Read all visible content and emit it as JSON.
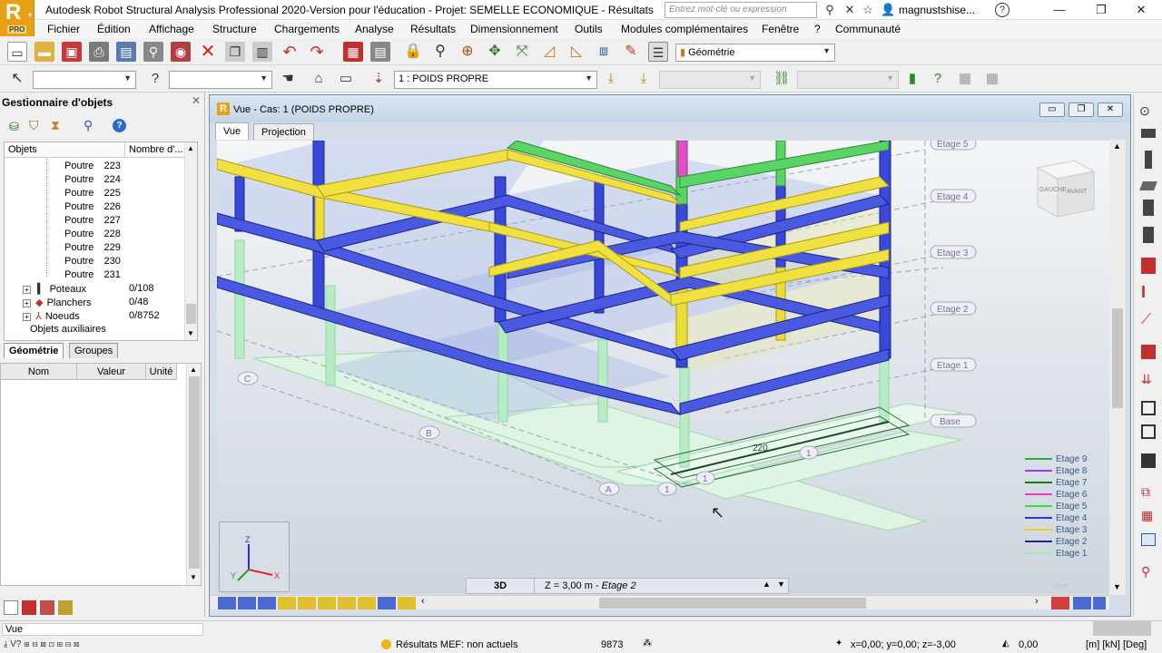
{
  "app": {
    "title": "Autodesk Robot Structural Analysis Professional 2020-Version pour l'éducation - Projet: SEMELLE ECONOMIQUE - Résultats MEF: non ...",
    "logo_letter": "R",
    "logo_badge": "PRO",
    "search_placeholder": "Entrez mot-clé ou expression",
    "user": "magnustshise...",
    "help": "?"
  },
  "menu": [
    "Fichier",
    "Édition",
    "Affichage",
    "Structure",
    "Chargements",
    "Analyse",
    "Résultats",
    "Dimensionnement",
    "Outils",
    "Modules complémentaires",
    "Fenêtre",
    "?",
    "Communauté"
  ],
  "toolbar": {
    "display_select": "Géométrie",
    "case_select": "1 : POIDS PROPRE",
    "combo_1": "",
    "combo_2": ""
  },
  "object_manager": {
    "title": "Gestionnaire d'objets",
    "col_objects": "Objets",
    "col_count": "Nombre d'...",
    "poutres": [
      {
        "label": "Poutre",
        "num": "223"
      },
      {
        "label": "Poutre",
        "num": "224"
      },
      {
        "label": "Poutre",
        "num": "225"
      },
      {
        "label": "Poutre",
        "num": "226"
      },
      {
        "label": "Poutre",
        "num": "227"
      },
      {
        "label": "Poutre",
        "num": "228"
      },
      {
        "label": "Poutre",
        "num": "229"
      },
      {
        "label": "Poutre",
        "num": "230"
      },
      {
        "label": "Poutre",
        "num": "231"
      }
    ],
    "groups": [
      {
        "label": "Poteaux",
        "count": "0/108"
      },
      {
        "label": "Planchers",
        "count": "0/48"
      },
      {
        "label": "Noeuds",
        "count": "0/8752"
      }
    ],
    "aux": "Objets auxiliaires",
    "tabs": [
      "Géométrie",
      "Groupes"
    ],
    "prop_cols": [
      "Nom",
      "Valeur",
      "Unité"
    ]
  },
  "view": {
    "title": "Vue - Cas: 1 (POIDS PROPRE)",
    "tabs": [
      "Vue",
      "Projection"
    ],
    "cube_left": "GAUCHE",
    "cube_right": "AVANT",
    "levels": [
      "Etage 5",
      "Etage 4",
      "Etage 3",
      "Etage 2",
      "Etage 1",
      "Base"
    ],
    "axis_letters": [
      "A",
      "B",
      "C"
    ],
    "axis_numbers": [
      "1",
      "1",
      "1"
    ],
    "beam_label": "220",
    "legend": [
      {
        "name": "Etage 9",
        "color": "#2ea83a"
      },
      {
        "name": "Etage 8",
        "color": "#9a3ce6"
      },
      {
        "name": "Etage 7",
        "color": "#1d7a24"
      },
      {
        "name": "Etage 6",
        "color": "#e63cc4"
      },
      {
        "name": "Etage 5",
        "color": "#3ed64a"
      },
      {
        "name": "Etage 4",
        "color": "#2a3ad6"
      },
      {
        "name": "Etage 3",
        "color": "#e6d22a"
      },
      {
        "name": "Etage 2",
        "color": "#1a2a8a"
      },
      {
        "name": "Etage 1",
        "color": "#9ee8b8"
      }
    ],
    "mode_3d": "3D",
    "z_level": "Z = 3,00 m",
    "z_level_name": "Etage 2",
    "vue_watermark": "Vue"
  },
  "status": {
    "left_field": "Vue",
    "results": "Résultats MEF: non actuels",
    "count": "9873",
    "coords": "x=0,00; y=0,00; z=-3,00",
    "value": "0,00",
    "units": "[m] [kN] [Deg]"
  }
}
